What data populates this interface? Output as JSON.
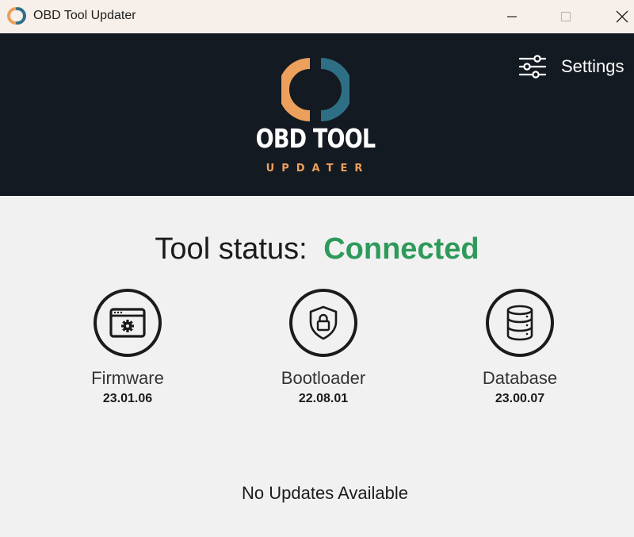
{
  "window": {
    "title": "OBD Tool Updater",
    "controls": {
      "minimize": "minimize-icon",
      "maximize": "maximize-icon",
      "close": "close-icon"
    }
  },
  "header": {
    "logo_title": "OBD TOOL",
    "logo_subtitle": "UPDATER",
    "settings_label": "Settings",
    "colors": {
      "background": "#141a21",
      "logo_orange": "#eca05c",
      "logo_teal": "#2e6f86"
    }
  },
  "status": {
    "label": "Tool status:",
    "value": "Connected",
    "value_color": "#2e9a5a"
  },
  "components": [
    {
      "name": "Firmware",
      "version": "23.01.06",
      "icon": "firmware-window-gear-icon"
    },
    {
      "name": "Bootloader",
      "version": "22.08.01",
      "icon": "shield-lock-icon"
    },
    {
      "name": "Database",
      "version": "23.00.07",
      "icon": "database-icon"
    }
  ],
  "footer": {
    "message": "No Updates Available"
  }
}
